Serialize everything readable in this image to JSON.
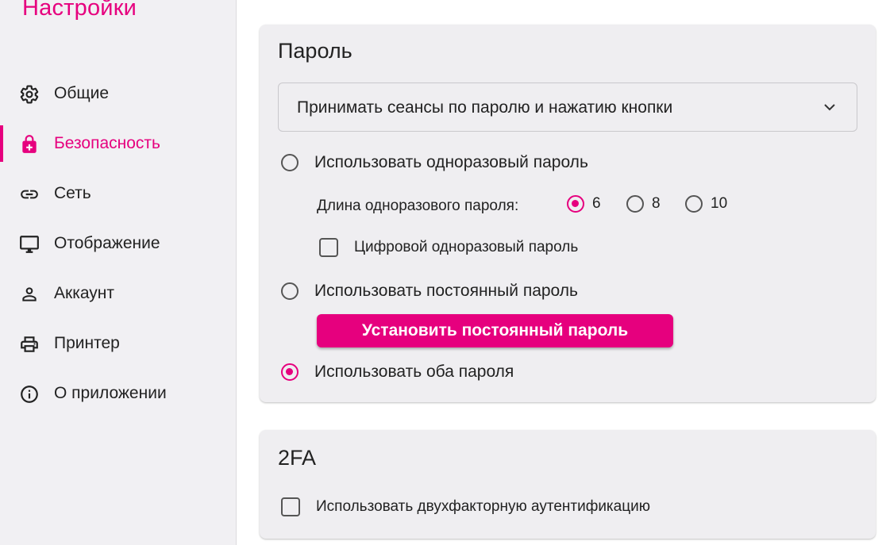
{
  "sidebar": {
    "title": "Настройки",
    "items": [
      {
        "label": "Общие",
        "icon": "gear-icon"
      },
      {
        "label": "Безопасность",
        "icon": "lock-icon",
        "active": true
      },
      {
        "label": "Сеть",
        "icon": "link-icon"
      },
      {
        "label": "Отображение",
        "icon": "monitor-icon"
      },
      {
        "label": "Аккаунт",
        "icon": "person-icon"
      },
      {
        "label": "Принтер",
        "icon": "printer-icon"
      },
      {
        "label": "О приложении",
        "icon": "info-icon"
      }
    ]
  },
  "password_card": {
    "title": "Пароль",
    "approve_mode": {
      "selected": "Принимать сеансы по паролю и нажатию кнопки"
    },
    "one_time": {
      "label": "Использовать одноразовый пароль",
      "selected": false,
      "length_label": "Длина одноразового пароля:",
      "length_options": [
        "6",
        "8",
        "10"
      ],
      "length_selected": "6",
      "numeric_label": "Цифровой одноразовый пароль",
      "numeric_checked": false
    },
    "permanent": {
      "label": "Использовать постоянный пароль",
      "selected": false,
      "button_label": "Установить постоянный пароль"
    },
    "both": {
      "label": "Использовать оба пароля",
      "selected": true
    }
  },
  "twofa_card": {
    "title": "2FA",
    "enable_label": "Использовать двухфакторную аутентификацию",
    "enabled": false
  },
  "colors": {
    "accent": "#e6007e",
    "sidebar_bg": "#f1f0f3",
    "card_bg": "#efeef1"
  }
}
